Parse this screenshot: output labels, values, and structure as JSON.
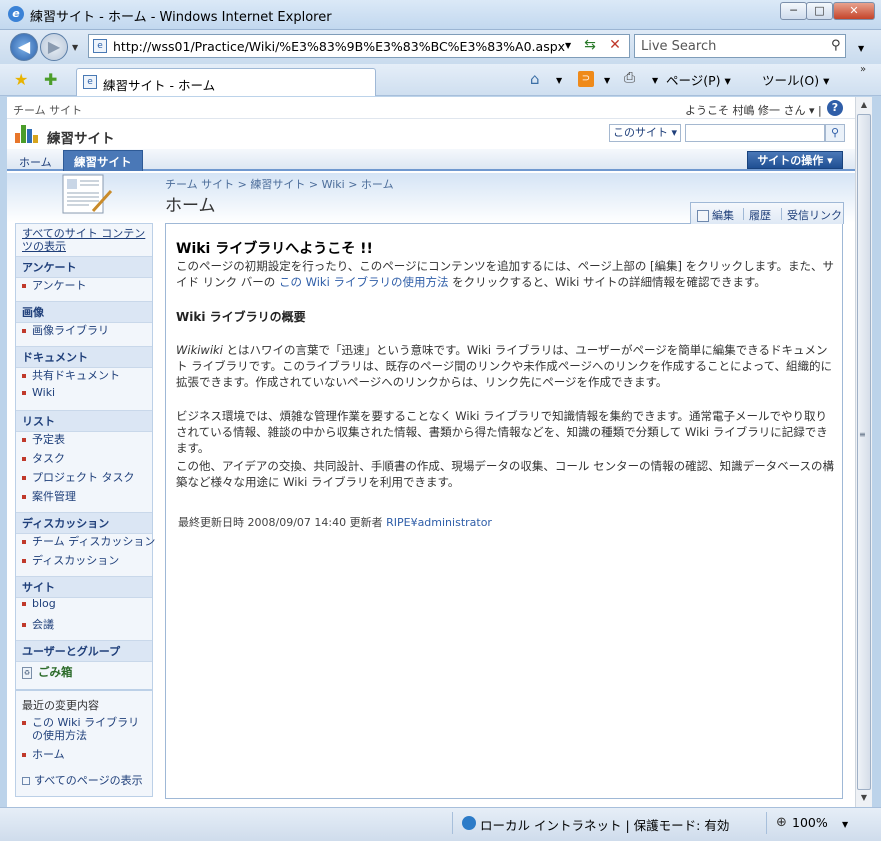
{
  "window": {
    "title": "練習サイト - ホーム - Windows Internet Explorer",
    "min_label": "─",
    "max_label": "□",
    "close_label": "✕"
  },
  "address": {
    "url": "http://wss01/Practice/Wiki/%E3%83%9B%E3%83%BC%E3%83%A0.aspx",
    "search_placeholder": "Live Search"
  },
  "tabs": {
    "active_label": "練習サイト - ホーム"
  },
  "commands": {
    "page_label": "ページ(P) ▾",
    "tools_label": "ツール(O) ▾"
  },
  "sharepoint": {
    "team_site": "チーム サイト",
    "welcome": "ようこそ 村嶋 修一 さん ▾ |",
    "site_title": "練習サイト",
    "scope": "このサイト ▾",
    "nav_home": "ホーム",
    "nav_current": "練習サイト",
    "site_actions": "サイトの操作 ▾",
    "breadcrumb": "チーム サイト > 練習サイト > Wiki > ホーム",
    "page_title": "ホーム"
  },
  "quicklaunch": {
    "view_all": "すべてのサイト コンテンツの表示",
    "sections": [
      {
        "heading": "アンケート",
        "items": [
          "アンケート"
        ]
      },
      {
        "heading": "画像",
        "items": [
          "画像ライブラリ"
        ]
      },
      {
        "heading": "ドキュメント",
        "items": [
          "共有ドキュメント",
          "Wiki"
        ]
      },
      {
        "heading": "リスト",
        "items": [
          "予定表",
          "タスク",
          "プロジェクト タスク",
          "案件管理"
        ]
      },
      {
        "heading": "ディスカッション",
        "items": [
          "チーム ディスカッション",
          "ディスカッション"
        ]
      },
      {
        "heading": "サイト",
        "items": [
          "blog",
          "会議"
        ]
      },
      {
        "heading": "ユーザーとグループ",
        "items": []
      }
    ],
    "recycle": "ごみ箱",
    "recent_heading": "最近の変更内容",
    "recent_items": [
      "この Wiki ライブラリの使用方法",
      "ホーム"
    ],
    "view_all_pages": "すべてのページの表示"
  },
  "content": {
    "tab_edit": "編集",
    "tab_history": "履歴",
    "tab_backlinks": "受信リンク",
    "heading": "Wiki ライブラリへようこそ !!",
    "p1_a": "このページの初期設定を行ったり、このページにコンテンツを追加するには、ページ上部の [編集] をクリックします。また、サイド リンク バーの ",
    "p1_link": "この Wiki ライブラリの使用方法",
    "p1_b": " をクリックすると、Wiki サイトの詳細情報を確認できます。",
    "overview": "Wiki ライブラリの概要",
    "p2_ital": "Wikiwiki",
    "p2": " とはハワイの言葉で「迅速」という意味です。Wiki ライブラリは、ユーザーがページを簡単に編集できるドキュメント ライブラリです。このライブラリは、既存のページ間のリンクや未作成ページへのリンクを作成することによって、組織的に拡張できます。作成されていないページへのリンクからは、リンク先にページを作成できます。",
    "p3": "ビジネス環境では、煩雑な管理作業を要することなく Wiki ライブラリで知識情報を集約できます。通常電子メールでやり取りされている情報、雑談の中から収集された情報、書類から得た情報などを、知識の種類で分類して Wiki ライブラリに記録できます。",
    "p4": "この他、アイデアの交換、共同設計、手順書の作成、現場データの収集、コール センターの情報の確認、知識データベースの構築など様々な用途に Wiki ライブラリを利用できます。",
    "lastmod_label": "最終更新日時 2008/09/07 14:40  更新者 ",
    "lastmod_user": "RIPE¥administrator"
  },
  "status": {
    "zone": "ローカル イントラネット | 保護モード: 有効",
    "zoom": "100%"
  }
}
